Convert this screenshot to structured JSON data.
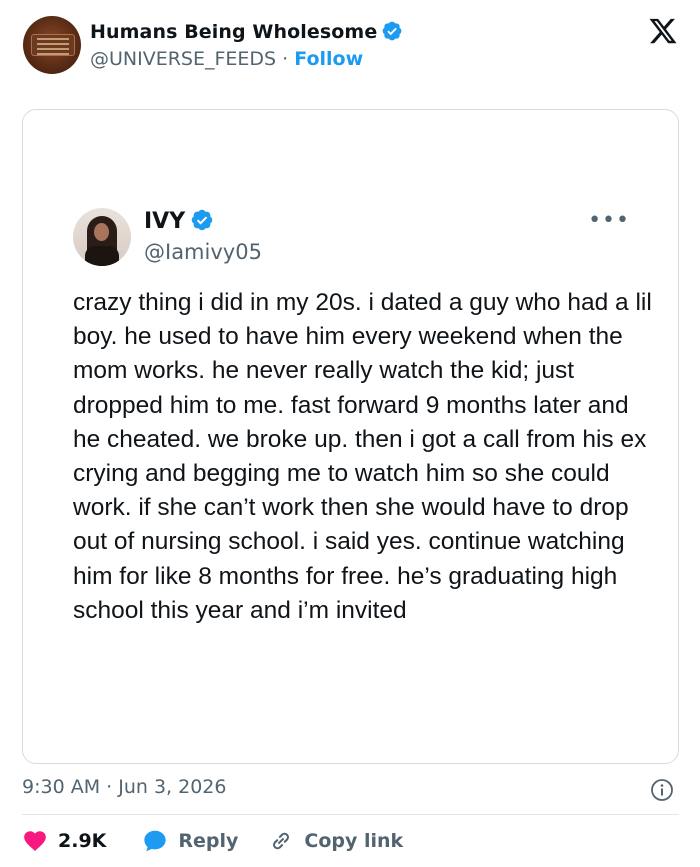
{
  "header": {
    "account_name": "Humans Being Wholesome",
    "account_handle": "@UNIVERSE_FEEDS",
    "separator": "·",
    "follow_label": "Follow"
  },
  "embedded_tweet": {
    "name": "IVY",
    "handle": "@Iamivy05",
    "text": "crazy thing i did in my 20s. i dated a guy who had a lil boy. he used to have him every weekend when the mom works. he never really watch the kid; just dropped him to me. fast forward 9 months later and he cheated. we broke up. then i got a call from his ex crying and begging me to watch him so she could work. if she can’t work then she would have to drop out of nursing school. i said yes. continue watching him for like 8 months for free. he’s graduating high school this year and i’m invited"
  },
  "footer": {
    "timestamp": "9:30 AM · Jun 3, 2026",
    "like_count": "2.9K",
    "reply_label": "Reply",
    "copy_link_label": "Copy link"
  },
  "icons": {
    "verified": "verified-badge-icon",
    "logo": "x-logo-icon",
    "more": "more-icon",
    "info": "info-icon",
    "like": "heart-icon",
    "reply": "reply-bubble-icon",
    "copy": "link-icon"
  },
  "colors": {
    "accent": "#1d9bf0",
    "like": "#f91880",
    "text": "#0f1419",
    "muted": "#536471"
  }
}
